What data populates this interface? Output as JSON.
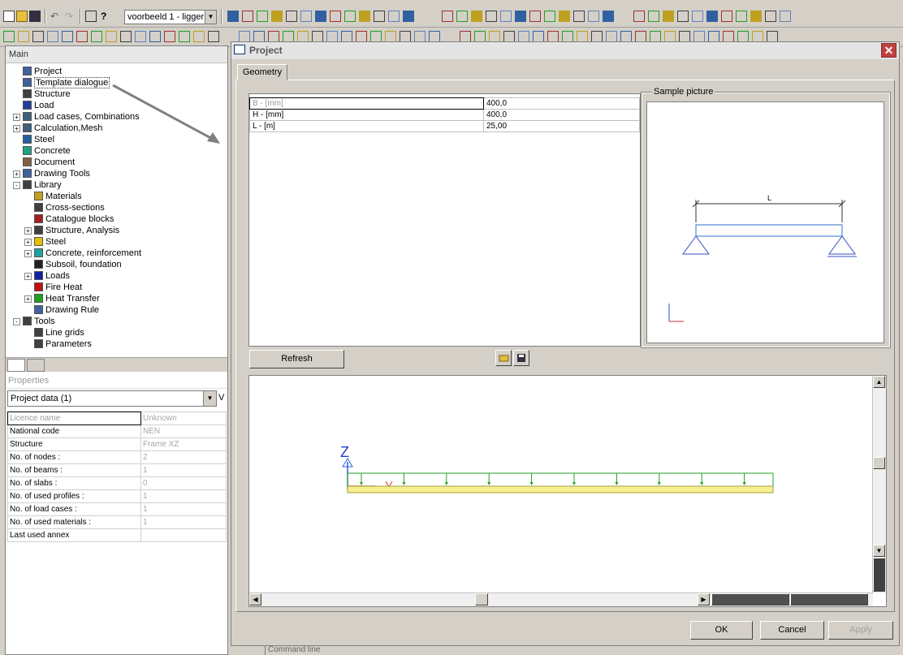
{
  "toolbar": {
    "config_select": "voorbeeld 1 - ligger"
  },
  "main_panel": {
    "title": "Main",
    "tree": [
      {
        "label": "Project",
        "level": 1,
        "expander": "",
        "icon": "project-icon",
        "color": "#4060a0"
      },
      {
        "label": "Template dialogue",
        "level": 1,
        "expander": "",
        "icon": "template-icon",
        "color": "#4060a0",
        "selected": true
      },
      {
        "label": "Structure",
        "level": 1,
        "expander": "",
        "icon": "structure-icon",
        "color": "#404040"
      },
      {
        "label": "Load",
        "level": 1,
        "expander": "",
        "icon": "load-icon",
        "color": "#2040a0"
      },
      {
        "label": "Load cases, Combinations",
        "level": 1,
        "expander": "+",
        "icon": "load-cases-icon",
        "color": "#406080"
      },
      {
        "label": "Calculation,Mesh",
        "level": 1,
        "expander": "+",
        "icon": "calculation-icon",
        "color": "#406080"
      },
      {
        "label": "Steel",
        "level": 1,
        "expander": "",
        "icon": "steel-icon",
        "color": "#2060a0"
      },
      {
        "label": "Concrete",
        "level": 1,
        "expander": "",
        "icon": "concrete-icon",
        "color": "#20a080"
      },
      {
        "label": "Document",
        "level": 1,
        "expander": "",
        "icon": "document-icon",
        "color": "#806040"
      },
      {
        "label": "Drawing Tools",
        "level": 1,
        "expander": "+",
        "icon": "drawing-tools-icon",
        "color": "#4060a0"
      },
      {
        "label": "Library",
        "level": 1,
        "expander": "-",
        "icon": "library-icon",
        "color": "#404040"
      },
      {
        "label": "Materials",
        "level": 2,
        "expander": "",
        "icon": "materials-icon",
        "color": "#c0a020"
      },
      {
        "label": "Cross-sections",
        "level": 2,
        "expander": "",
        "icon": "cross-sections-icon",
        "color": "#404040"
      },
      {
        "label": "Catalogue blocks",
        "level": 2,
        "expander": "",
        "icon": "catalogue-blocks-icon",
        "color": "#a02020"
      },
      {
        "label": "Structure, Analysis",
        "level": 2,
        "expander": "+",
        "icon": "structure-analysis-icon",
        "color": "#404040"
      },
      {
        "label": "Steel",
        "level": 2,
        "expander": "+",
        "icon": "steel-library-icon",
        "color": "#e0c000"
      },
      {
        "label": "Concrete, reinforcement",
        "level": 2,
        "expander": "+",
        "icon": "concrete-reinforcement-icon",
        "color": "#20a0a0"
      },
      {
        "label": "Subsoil, foundation",
        "level": 2,
        "expander": "",
        "icon": "subsoil-icon",
        "color": "#202020"
      },
      {
        "label": "Loads",
        "level": 2,
        "expander": "+",
        "icon": "loads-icon",
        "color": "#1020a0"
      },
      {
        "label": "Fire Heat",
        "level": 2,
        "expander": "",
        "icon": "fire-heat-icon",
        "color": "#c01010"
      },
      {
        "label": "Heat Transfer",
        "level": 2,
        "expander": "+",
        "icon": "heat-transfer-icon",
        "color": "#20a020"
      },
      {
        "label": "Drawing Rule",
        "level": 2,
        "expander": "",
        "icon": "drawing-rule-icon",
        "color": "#4060a0"
      },
      {
        "label": "Tools",
        "level": 1,
        "expander": "-",
        "icon": "tools-icon",
        "color": "#404040"
      },
      {
        "label": "Line grids",
        "level": 2,
        "expander": "",
        "icon": "line-grids-icon",
        "color": "#404040"
      },
      {
        "label": "Parameters",
        "level": 2,
        "expander": "",
        "icon": "parameters-icon",
        "color": "#404040"
      }
    ],
    "properties_title": "Properties",
    "properties_select": "Project data (1)",
    "properties": [
      {
        "key": "Licence name",
        "value": "Unknown",
        "dim_key": true
      },
      {
        "key": "National code",
        "value": "NEN"
      },
      {
        "key": "Structure",
        "value": "Frame XZ"
      },
      {
        "key": "No. of nodes :",
        "value": "2"
      },
      {
        "key": "No. of beams :",
        "value": "1"
      },
      {
        "key": "No. of slabs :",
        "value": "0"
      },
      {
        "key": "No. of used profiles :",
        "value": "1"
      },
      {
        "key": "No. of load cases :",
        "value": "1"
      },
      {
        "key": "No. of used materials :",
        "value": "1"
      },
      {
        "key": "Last used annex",
        "value": ""
      }
    ]
  },
  "dialog": {
    "title": "Project",
    "tab": "Geometry",
    "parameters": [
      {
        "name": "B - [mm]",
        "value": "400,0",
        "dim": true
      },
      {
        "name": "H - [mm]",
        "value": "400,0"
      },
      {
        "name": "L - [m]",
        "value": "25,00"
      }
    ],
    "sample_label": "Sample picture",
    "sample_dim": "L",
    "refresh": "Refresh",
    "ok": "OK",
    "cancel": "Cancel",
    "apply": "Apply",
    "axis_label": "Z"
  },
  "command_line": "Command line"
}
